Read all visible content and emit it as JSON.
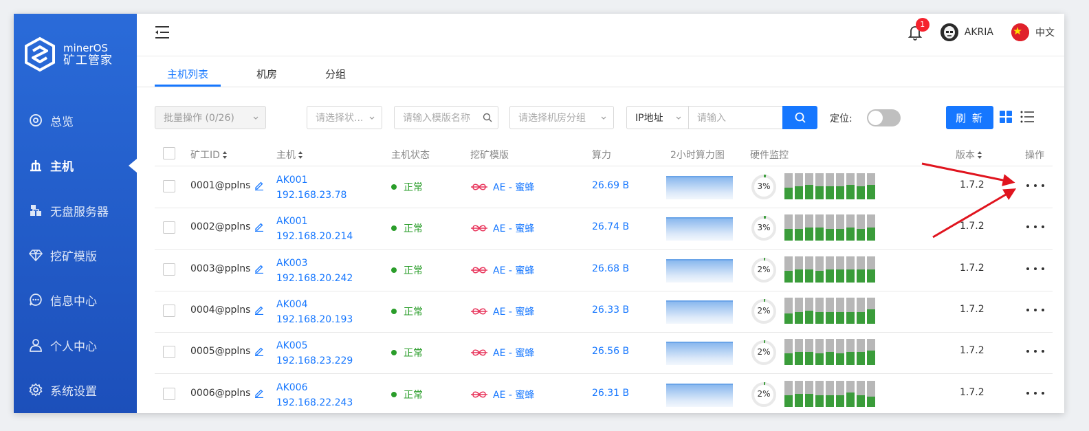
{
  "brand": {
    "name_en": "minerOS",
    "name_cn": "矿工管家"
  },
  "sidebar": {
    "items": [
      {
        "label": "总览",
        "icon": "dashboard-icon"
      },
      {
        "label": "主机",
        "icon": "host-icon",
        "active": true
      },
      {
        "label": "无盘服务器",
        "icon": "server-icon"
      },
      {
        "label": "挖矿模版",
        "icon": "diamond-icon"
      },
      {
        "label": "信息中心",
        "icon": "message-icon"
      },
      {
        "label": "个人中心",
        "icon": "user-icon"
      },
      {
        "label": "系统设置",
        "icon": "gear-icon"
      }
    ]
  },
  "header": {
    "notification_count": "1",
    "username": "AKRIA",
    "language": "中文"
  },
  "tabs": [
    {
      "label": "主机列表",
      "active": true
    },
    {
      "label": "机房"
    },
    {
      "label": "分组"
    }
  ],
  "toolbar": {
    "batch_label": "批量操作 (0/26)",
    "status_placeholder": "请选择状...",
    "template_placeholder": "请输入模版名称",
    "room_placeholder": "请选择机房分组",
    "ip_type": "IP地址",
    "ip_placeholder": "请输入",
    "locate_label": "定位:",
    "refresh_label": "刷 新"
  },
  "table": {
    "columns": {
      "id": "矿工ID",
      "host": "主机",
      "status": "主机状态",
      "template": "挖矿模版",
      "hashrate": "算力",
      "chart": "2小时算力图",
      "hardware": "硬件监控",
      "version": "版本",
      "ops": "操作"
    },
    "rows": [
      {
        "id": "0001@pplns",
        "host": "AK001",
        "ip": "192.168.23.78",
        "status": "正常",
        "template": "AE - 蜜蜂",
        "hashrate": "26.69 B",
        "usage": "3%",
        "usage_value": 0.03,
        "version": "1.7.2",
        "gpu_levels": [
          0.45,
          0.5,
          0.55,
          0.5,
          0.5,
          0.5,
          0.55,
          0.5,
          0.55
        ]
      },
      {
        "id": "0002@pplns",
        "host": "AK001",
        "ip": "192.168.20.214",
        "status": "正常",
        "template": "AE - 蜜蜂",
        "hashrate": "26.74 B",
        "usage": "3%",
        "usage_value": 0.03,
        "version": "1.7.2",
        "gpu_levels": [
          0.45,
          0.45,
          0.5,
          0.5,
          0.45,
          0.45,
          0.5,
          0.45,
          0.5
        ]
      },
      {
        "id": "0003@pplns",
        "host": "AK003",
        "ip": "192.168.20.242",
        "status": "正常",
        "template": "AE - 蜜蜂",
        "hashrate": "26.68 B",
        "usage": "2%",
        "usage_value": 0.02,
        "version": "1.7.2",
        "gpu_levels": [
          0.45,
          0.5,
          0.5,
          0.45,
          0.5,
          0.5,
          0.5,
          0.5,
          0.5
        ]
      },
      {
        "id": "0004@pplns",
        "host": "AK004",
        "ip": "192.168.20.193",
        "status": "正常",
        "template": "AE - 蜜蜂",
        "hashrate": "26.33 B",
        "usage": "2%",
        "usage_value": 0.02,
        "version": "1.7.2",
        "gpu_levels": [
          0.4,
          0.45,
          0.5,
          0.45,
          0.45,
          0.45,
          0.45,
          0.45,
          0.55
        ]
      },
      {
        "id": "0005@pplns",
        "host": "AK005",
        "ip": "192.168.23.229",
        "status": "正常",
        "template": "AE - 蜜蜂",
        "hashrate": "26.56 B",
        "usage": "2%",
        "usage_value": 0.02,
        "version": "1.7.2",
        "gpu_levels": [
          0.45,
          0.5,
          0.5,
          0.45,
          0.5,
          0.45,
          0.5,
          0.5,
          0.55
        ]
      },
      {
        "id": "0006@pplns",
        "host": "AK006",
        "ip": "192.168.22.243",
        "status": "正常",
        "template": "AE - 蜜蜂",
        "hashrate": "26.31 B",
        "usage": "2%",
        "usage_value": 0.02,
        "version": "1.7.2",
        "gpu_levels": [
          0.45,
          0.5,
          0.5,
          0.45,
          0.45,
          0.45,
          0.55,
          0.45,
          0.4
        ]
      }
    ]
  },
  "colors": {
    "sidebar": "#1f5cc6",
    "accent": "#1677ff",
    "ok": "#2a9d2a",
    "arrow": "#e0141e"
  }
}
